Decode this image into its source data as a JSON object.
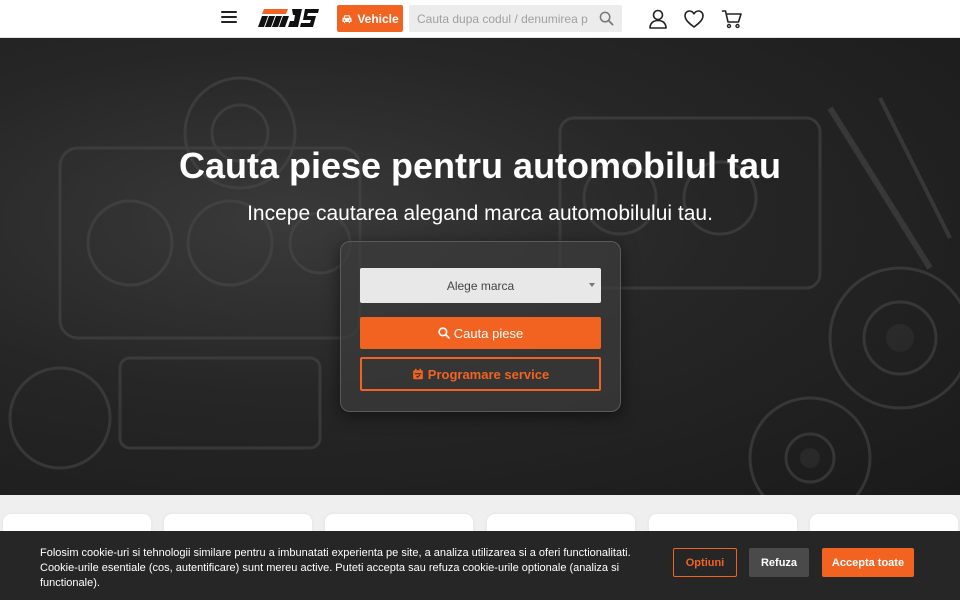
{
  "header": {
    "vehicle_label": "Vehicle",
    "search_placeholder": "Cauta dupa codul / denumirea p"
  },
  "hero": {
    "title": "Cauta piese pentru automobilul tau",
    "subtitle": "Incepe cautarea alegand marca automobilului tau.",
    "brand_select": "Alege marca",
    "search_button": "Cauta piese",
    "service_button": "Programare service"
  },
  "cookie": {
    "text": "Folosim cookie-uri si tehnologii similare pentru a imbunatati experienta pe site, a analiza utilizarea si a oferi functionalitati. Cookie-urile esentiale (cos, autentificare) sunt mereu active. Puteti accepta sau refuza cookie-urile optionale (analiza si functionale).",
    "options_label": "Optiuni",
    "refuse_label": "Refuza",
    "accept_label": "Accepta toate"
  },
  "colors": {
    "accent": "#f26322",
    "cookie_bg": "#262626",
    "header_bg": "#ffffff"
  },
  "icons": [
    "menu-icon",
    "logo",
    "car-icon",
    "search-icon",
    "user-icon",
    "heart-icon",
    "cart-icon",
    "calendar-icon"
  ]
}
